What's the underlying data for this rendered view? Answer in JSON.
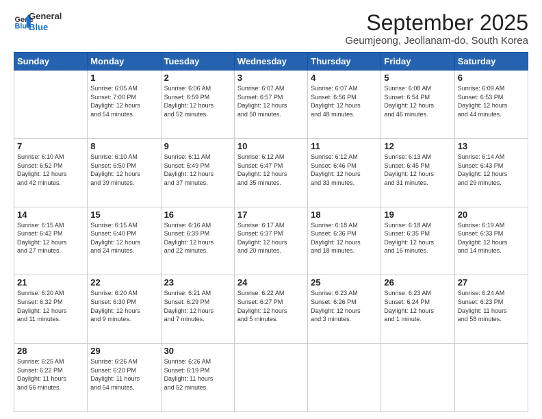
{
  "logo": {
    "line1": "General",
    "line2": "Blue"
  },
  "title": "September 2025",
  "subtitle": "Geumjeong, Jeollanam-do, South Korea",
  "header_days": [
    "Sunday",
    "Monday",
    "Tuesday",
    "Wednesday",
    "Thursday",
    "Friday",
    "Saturday"
  ],
  "weeks": [
    [
      {
        "day": "",
        "info": ""
      },
      {
        "day": "1",
        "info": "Sunrise: 6:05 AM\nSunset: 7:00 PM\nDaylight: 12 hours\nand 54 minutes."
      },
      {
        "day": "2",
        "info": "Sunrise: 6:06 AM\nSunset: 6:59 PM\nDaylight: 12 hours\nand 52 minutes."
      },
      {
        "day": "3",
        "info": "Sunrise: 6:07 AM\nSunset: 6:57 PM\nDaylight: 12 hours\nand 50 minutes."
      },
      {
        "day": "4",
        "info": "Sunrise: 6:07 AM\nSunset: 6:56 PM\nDaylight: 12 hours\nand 48 minutes."
      },
      {
        "day": "5",
        "info": "Sunrise: 6:08 AM\nSunset: 6:54 PM\nDaylight: 12 hours\nand 46 minutes."
      },
      {
        "day": "6",
        "info": "Sunrise: 6:09 AM\nSunset: 6:53 PM\nDaylight: 12 hours\nand 44 minutes."
      }
    ],
    [
      {
        "day": "7",
        "info": "Sunrise: 6:10 AM\nSunset: 6:52 PM\nDaylight: 12 hours\nand 42 minutes."
      },
      {
        "day": "8",
        "info": "Sunrise: 6:10 AM\nSunset: 6:50 PM\nDaylight: 12 hours\nand 39 minutes."
      },
      {
        "day": "9",
        "info": "Sunrise: 6:11 AM\nSunset: 6:49 PM\nDaylight: 12 hours\nand 37 minutes."
      },
      {
        "day": "10",
        "info": "Sunrise: 6:12 AM\nSunset: 6:47 PM\nDaylight: 12 hours\nand 35 minutes."
      },
      {
        "day": "11",
        "info": "Sunrise: 6:12 AM\nSunset: 6:46 PM\nDaylight: 12 hours\nand 33 minutes."
      },
      {
        "day": "12",
        "info": "Sunrise: 6:13 AM\nSunset: 6:45 PM\nDaylight: 12 hours\nand 31 minutes."
      },
      {
        "day": "13",
        "info": "Sunrise: 6:14 AM\nSunset: 6:43 PM\nDaylight: 12 hours\nand 29 minutes."
      }
    ],
    [
      {
        "day": "14",
        "info": "Sunrise: 6:15 AM\nSunset: 6:42 PM\nDaylight: 12 hours\nand 27 minutes."
      },
      {
        "day": "15",
        "info": "Sunrise: 6:15 AM\nSunset: 6:40 PM\nDaylight: 12 hours\nand 24 minutes."
      },
      {
        "day": "16",
        "info": "Sunrise: 6:16 AM\nSunset: 6:39 PM\nDaylight: 12 hours\nand 22 minutes."
      },
      {
        "day": "17",
        "info": "Sunrise: 6:17 AM\nSunset: 6:37 PM\nDaylight: 12 hours\nand 20 minutes."
      },
      {
        "day": "18",
        "info": "Sunrise: 6:18 AM\nSunset: 6:36 PM\nDaylight: 12 hours\nand 18 minutes."
      },
      {
        "day": "19",
        "info": "Sunrise: 6:18 AM\nSunset: 6:35 PM\nDaylight: 12 hours\nand 16 minutes."
      },
      {
        "day": "20",
        "info": "Sunrise: 6:19 AM\nSunset: 6:33 PM\nDaylight: 12 hours\nand 14 minutes."
      }
    ],
    [
      {
        "day": "21",
        "info": "Sunrise: 6:20 AM\nSunset: 6:32 PM\nDaylight: 12 hours\nand 11 minutes."
      },
      {
        "day": "22",
        "info": "Sunrise: 6:20 AM\nSunset: 6:30 PM\nDaylight: 12 hours\nand 9 minutes."
      },
      {
        "day": "23",
        "info": "Sunrise: 6:21 AM\nSunset: 6:29 PM\nDaylight: 12 hours\nand 7 minutes."
      },
      {
        "day": "24",
        "info": "Sunrise: 6:22 AM\nSunset: 6:27 PM\nDaylight: 12 hours\nand 5 minutes."
      },
      {
        "day": "25",
        "info": "Sunrise: 6:23 AM\nSunset: 6:26 PM\nDaylight: 12 hours\nand 3 minutes."
      },
      {
        "day": "26",
        "info": "Sunrise: 6:23 AM\nSunset: 6:24 PM\nDaylight: 12 hours\nand 1 minute."
      },
      {
        "day": "27",
        "info": "Sunrise: 6:24 AM\nSunset: 6:23 PM\nDaylight: 11 hours\nand 58 minutes."
      }
    ],
    [
      {
        "day": "28",
        "info": "Sunrise: 6:25 AM\nSunset: 6:22 PM\nDaylight: 11 hours\nand 56 minutes."
      },
      {
        "day": "29",
        "info": "Sunrise: 6:26 AM\nSunset: 6:20 PM\nDaylight: 11 hours\nand 54 minutes."
      },
      {
        "day": "30",
        "info": "Sunrise: 6:26 AM\nSunset: 6:19 PM\nDaylight: 11 hours\nand 52 minutes."
      },
      {
        "day": "",
        "info": ""
      },
      {
        "day": "",
        "info": ""
      },
      {
        "day": "",
        "info": ""
      },
      {
        "day": "",
        "info": ""
      }
    ]
  ]
}
